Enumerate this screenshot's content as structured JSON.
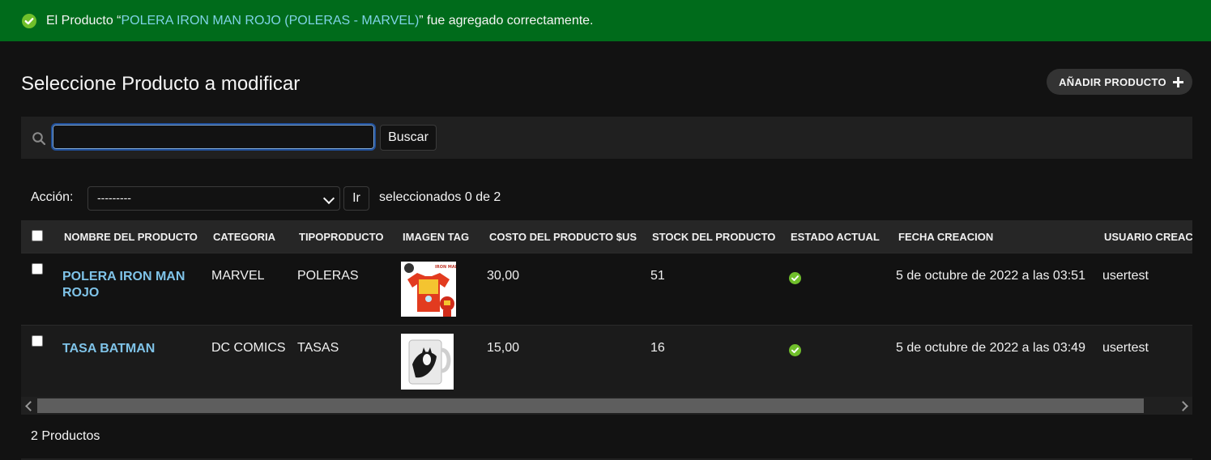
{
  "message": {
    "prefix": "El Producto “",
    "link": "POLERA IRON MAN ROJO (POLERAS - MARVEL)",
    "suffix": "” fue agregado correctamente.",
    "icon": "check-circle-icon",
    "color": "#006b1b"
  },
  "header": {
    "title": "Seleccione Producto a modificar",
    "add_button": "AÑADIR PRODUCTO"
  },
  "search": {
    "value": "",
    "button": "Buscar",
    "icon": "search-icon"
  },
  "actions": {
    "label": "Acción:",
    "selected": "---------",
    "go_button": "Ir",
    "selection_count": "seleccionados 0 de 2"
  },
  "table": {
    "columns": [
      "NOMBRE DEL PRODUCTO",
      "CATEGORIA",
      "TIPOPRODUCTO",
      "IMAGEN TAG",
      "COSTO DEL PRODUCTO $US",
      "STOCK DEL PRODUCTO",
      "ESTADO ACTUAL",
      "FECHA CREACION",
      "USUARIO CREACI"
    ],
    "rows": [
      {
        "name": "POLERA IRON MAN ROJO",
        "category": "MARVEL",
        "type": "POLERAS",
        "image": "ironman-shirt-thumbnail",
        "cost": "30,00",
        "stock": "51",
        "status": "check-circle-icon",
        "created": "5 de octubre de 2022 a las 03:51",
        "user": "usertest"
      },
      {
        "name": "TASA BATMAN",
        "category": "DC COMICS",
        "type": "TASAS",
        "image": "batman-mug-thumbnail",
        "cost": "15,00",
        "stock": "16",
        "status": "check-circle-icon",
        "created": "5 de octubre de 2022 a las 03:49",
        "user": "usertest"
      }
    ]
  },
  "footer": {
    "count": "2 Productos"
  }
}
